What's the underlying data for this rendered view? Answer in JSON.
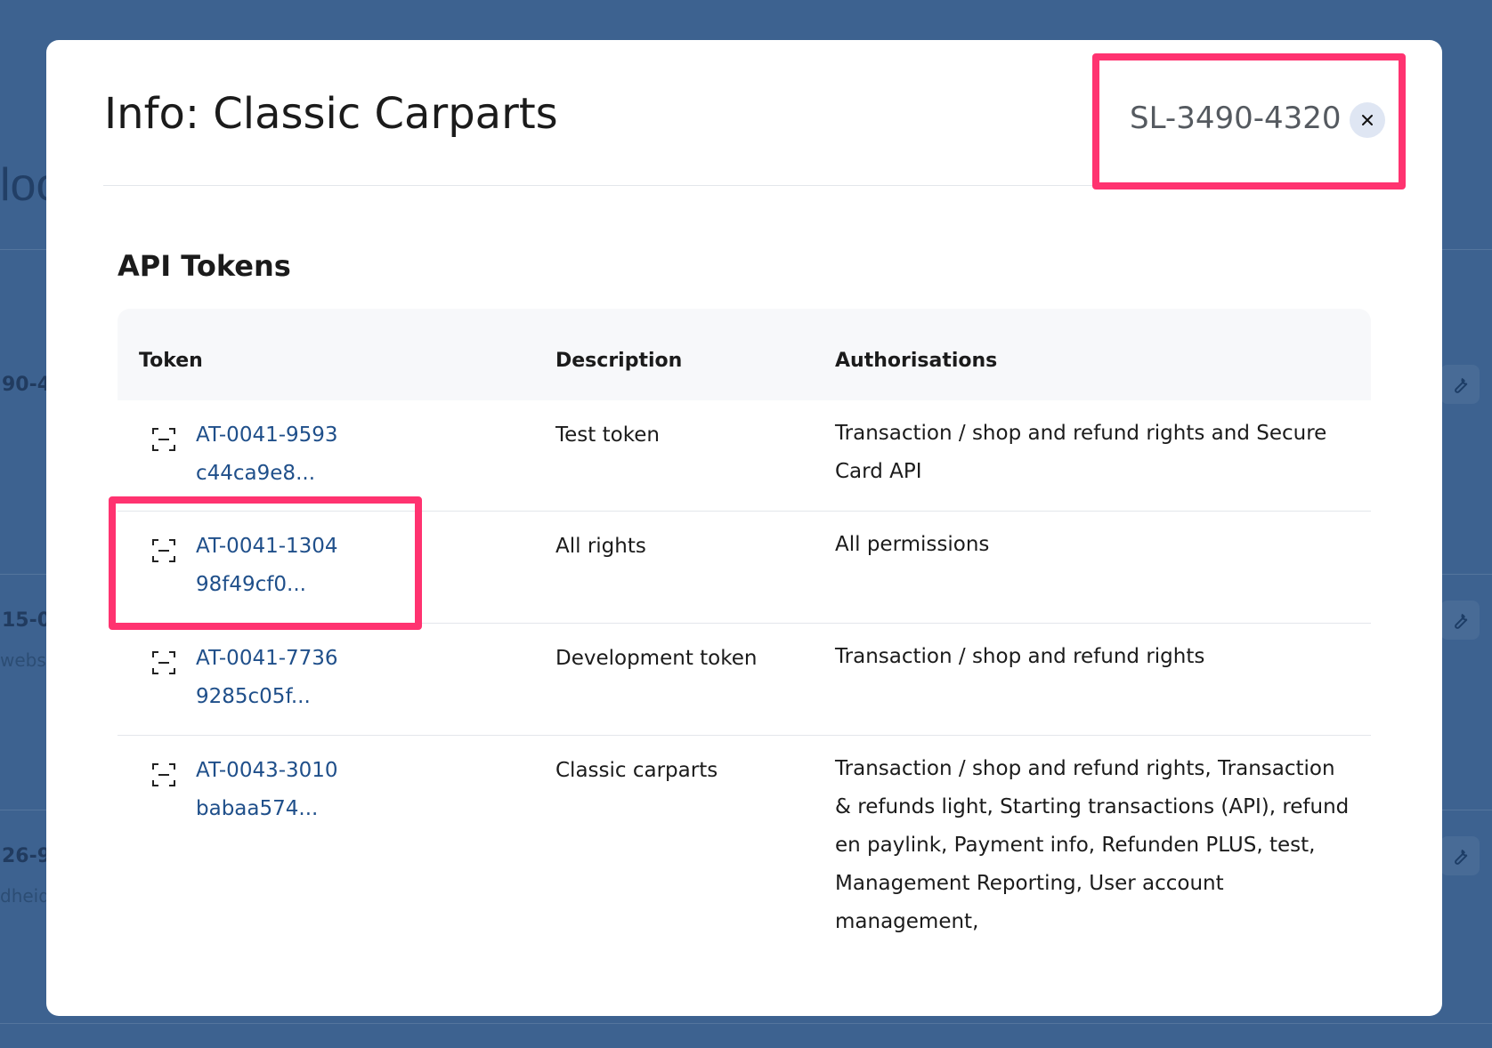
{
  "background": {
    "title_fragment": "loo",
    "row_fragments": [
      {
        "number": "90-4",
        "sub": ""
      },
      {
        "number": "15-0",
        "sub": "websh"
      },
      {
        "number": "26-9",
        "sub": "dheid"
      }
    ],
    "tool_icon": "wrench-icon"
  },
  "modal": {
    "title": "Info: Classic Carparts",
    "account_id": "SL-3490-4320",
    "close_icon": "close-icon",
    "section_title": "API Tokens",
    "columns": {
      "token": "Token",
      "description": "Description",
      "authorisations": "Authorisations"
    },
    "rows": [
      {
        "token_id": "AT-0041-9593",
        "token_hash": "c44ca9e8...",
        "description": "Test token",
        "authorisations": "Transaction / shop and refund rights and Secure Card API"
      },
      {
        "token_id": "AT-0041-1304",
        "token_hash": "98f49cf0...",
        "description": "All rights",
        "authorisations": "All permissions"
      },
      {
        "token_id": "AT-0041-7736",
        "token_hash": "9285c05f...",
        "description": "Development token",
        "authorisations": "Transaction / shop and refund rights"
      },
      {
        "token_id": "AT-0043-3010",
        "token_hash": "babaa574...",
        "description": "Classic carparts",
        "authorisations": "Transaction / shop and refund rights, Transaction & refunds light, Starting transactions (API), refund en paylink, Payment info, Refunden PLUS, test, Management Reporting, User account management,"
      }
    ]
  },
  "colors": {
    "backdrop": "#3d6290",
    "link": "#1f4f8a",
    "highlight": "#ff3370"
  }
}
